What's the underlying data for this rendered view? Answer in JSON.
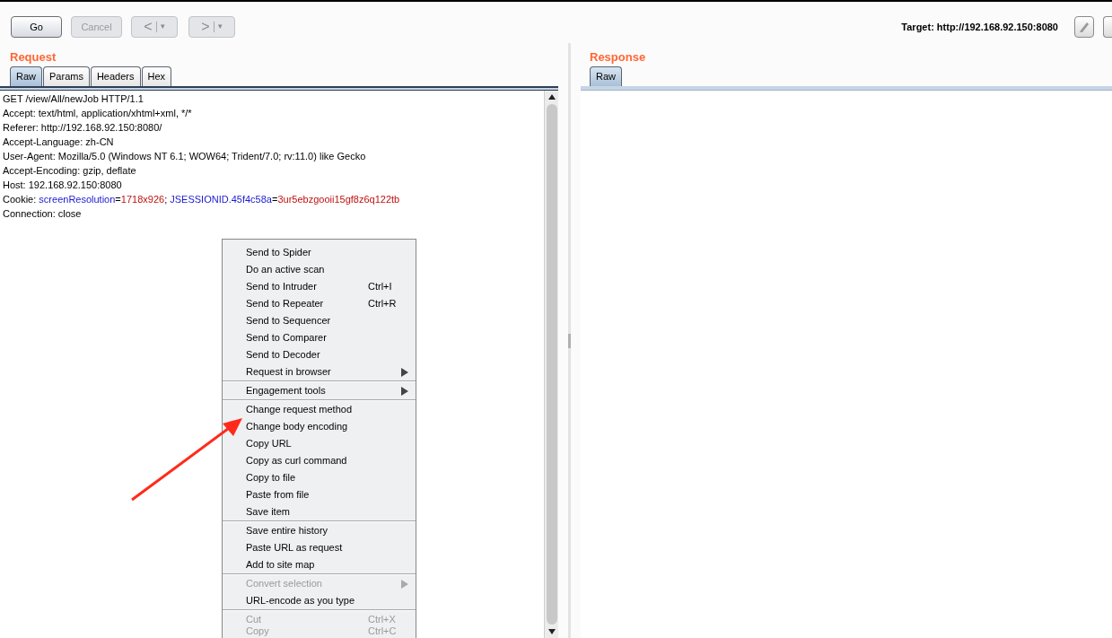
{
  "toolbar": {
    "buttons": [
      {
        "label": "Go",
        "disabled": false
      },
      {
        "label": "Cancel",
        "disabled": true
      }
    ],
    "history": [
      {
        "glyph": "<",
        "caret": "▾",
        "disabled": true
      },
      {
        "glyph": ">",
        "caret": "▾",
        "disabled": true
      }
    ],
    "target": "Target: http://192.168.92.150:8080"
  },
  "request": {
    "title": "Request",
    "tabs": [
      {
        "label": "Raw",
        "selected": true
      },
      {
        "label": "Params",
        "selected": false
      },
      {
        "label": "Headers",
        "selected": false
      },
      {
        "label": "Hex",
        "selected": false
      }
    ],
    "lines": [
      [
        {
          "kind": "plain",
          "text": "GET /view/All/newJob HTTP/1.1"
        }
      ],
      [
        {
          "kind": "plain",
          "text": "Accept: text/html, application/xhtml+xml, */*"
        }
      ],
      [
        {
          "kind": "plain",
          "text": "Referer: http://192.168.92.150:8080/"
        }
      ],
      [
        {
          "kind": "plain",
          "text": "Accept-Language: zh-CN"
        }
      ],
      [
        {
          "kind": "plain",
          "text": "User-Agent: Mozilla/5.0 (Windows NT 6.1; WOW64; Trident/7.0; rv:11.0) like Gecko"
        }
      ],
      [
        {
          "kind": "plain",
          "text": "Accept-Encoding: gzip, deflate"
        }
      ],
      [
        {
          "kind": "plain",
          "text": "Host: 192.168.92.150:8080"
        }
      ],
      [
        {
          "kind": "plain",
          "text": "Cookie: "
        },
        {
          "kind": "key",
          "text": "screenResolution"
        },
        {
          "kind": "plain",
          "text": "="
        },
        {
          "kind": "value",
          "text": "1718x926"
        },
        {
          "kind": "plain",
          "text": "; "
        },
        {
          "kind": "key",
          "text": "JSESSIONID.45f4c58a"
        },
        {
          "kind": "plain",
          "text": "="
        },
        {
          "kind": "value",
          "text": "3ur5ebzgooii15gf8z6q122tb"
        }
      ],
      [
        {
          "kind": "plain",
          "text": "Connection: close"
        }
      ]
    ]
  },
  "response": {
    "title": "Response",
    "tabs": [
      {
        "label": "Raw",
        "selected": true
      }
    ]
  },
  "context_menu": {
    "groups": [
      [
        {
          "label": "Send to Spider",
          "disabled": false
        },
        {
          "label": "Do an active scan",
          "disabled": false
        },
        {
          "label": "Send to Intruder",
          "shortcut": "Ctrl+I",
          "disabled": false
        },
        {
          "label": "Send to Repeater",
          "shortcut": "Ctrl+R",
          "disabled": false
        },
        {
          "label": "Send to Sequencer",
          "disabled": false
        },
        {
          "label": "Send to Comparer",
          "disabled": false
        },
        {
          "label": "Send to Decoder",
          "disabled": false
        },
        {
          "label": "Request in browser",
          "submenu": true,
          "disabled": false
        }
      ],
      [
        {
          "label": "Engagement tools",
          "submenu": true,
          "disabled": false
        }
      ],
      [
        {
          "label": "Change request method",
          "disabled": false
        },
        {
          "label": "Change body encoding",
          "disabled": false
        },
        {
          "label": "Copy URL",
          "disabled": false
        },
        {
          "label": "Copy as curl command",
          "disabled": false
        },
        {
          "label": "Copy to file",
          "disabled": false
        },
        {
          "label": "Paste from file",
          "disabled": false
        },
        {
          "label": "Save item",
          "disabled": false
        }
      ],
      [
        {
          "label": "Save entire history",
          "disabled": false
        },
        {
          "label": "Paste URL as request",
          "disabled": false
        },
        {
          "label": "Add to site map",
          "disabled": false
        }
      ],
      [
        {
          "label": "Convert selection",
          "submenu": true,
          "disabled": true
        },
        {
          "label": "URL-encode as you type",
          "disabled": false
        }
      ],
      [
        {
          "label": "Cut",
          "shortcut": "Ctrl+X",
          "disabled": true
        },
        {
          "label": "Copy",
          "shortcut": "Ctrl+C",
          "disabled": true
        }
      ]
    ]
  }
}
